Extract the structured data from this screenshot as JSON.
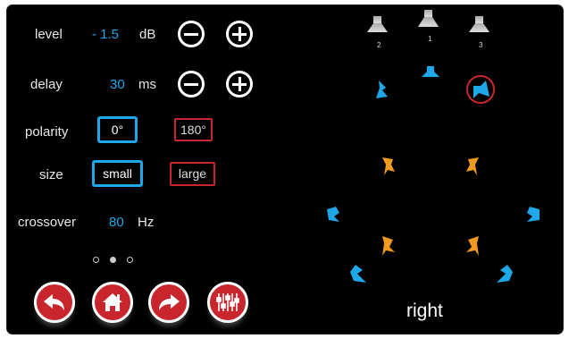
{
  "controls": {
    "level": {
      "label": "level",
      "value": "- 1.5",
      "unit": "dB"
    },
    "delay": {
      "label": "delay",
      "value": "30",
      "unit": "ms"
    },
    "polarity": {
      "label": "polarity",
      "options": [
        "0°",
        "180°"
      ],
      "selected": "0°"
    },
    "size": {
      "label": "size",
      "options": [
        "small",
        "large"
      ],
      "selected": "small"
    },
    "crossover": {
      "label": "crossover",
      "value": "80",
      "unit": "Hz"
    }
  },
  "pager": {
    "pages": 3,
    "current": 2
  },
  "nav": {
    "icons": [
      "back-arrow-icon",
      "home-icon",
      "forward-arrow-icon",
      "equalizer-icon"
    ]
  },
  "speaker_map": {
    "front_speakers": [
      "2",
      "1",
      "3"
    ],
    "selected_channel": "right"
  },
  "colors": {
    "accent_blue": "#1ea7e9",
    "accent_red": "#c8262c",
    "accent_orange": "#f29a1f",
    "background": "#000000"
  }
}
